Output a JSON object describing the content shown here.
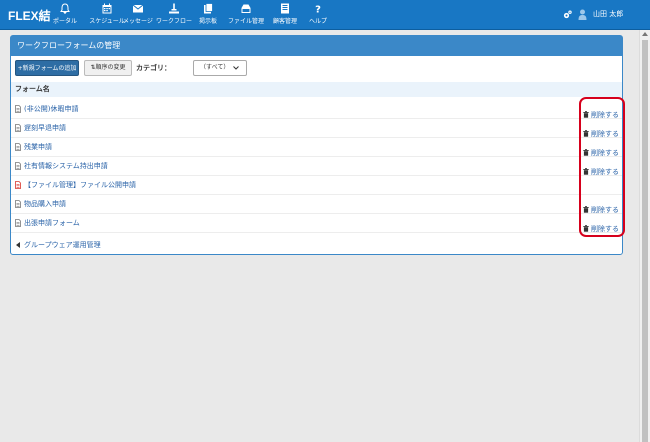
{
  "app": {
    "logo": "FLEX結",
    "nav": [
      {
        "label": "ポータル",
        "icon": "bell-icon"
      },
      {
        "label": "スケジュール",
        "icon": "calendar-icon"
      },
      {
        "label": "メッセージ",
        "icon": "envelope-icon"
      },
      {
        "label": "ワークフロー",
        "icon": "workflow-icon"
      },
      {
        "label": "掲示板",
        "icon": "board-icon"
      },
      {
        "label": "ファイル管理",
        "icon": "file-icon"
      },
      {
        "label": "顧客管理",
        "icon": "customer-icon"
      },
      {
        "label": "ヘルプ",
        "icon": "help-icon"
      }
    ],
    "user_name": "山田 太郎"
  },
  "panel": {
    "title": "ワークフローフォームの管理",
    "new_form_button": "+新規フォームの追加",
    "reorder_button": "順序の変更",
    "category_label": "カテゴリ：",
    "category_value": "（すべて）"
  },
  "table": {
    "column_header": "フォーム名",
    "rows": [
      {
        "name": "(非公開)休暇申請",
        "delete": "削除する",
        "icon_color": "#777777"
      },
      {
        "name": "遅刻早退申請",
        "delete": "削除する",
        "icon_color": "#777777"
      },
      {
        "name": "残業申請",
        "delete": "削除する",
        "icon_color": "#777777"
      },
      {
        "name": "社有情報システム持出申請",
        "delete": "削除する",
        "icon_color": "#777777"
      },
      {
        "name": "【ファイル管理】ファイル公開申請",
        "delete": "",
        "icon_color": "#d9342b"
      },
      {
        "name": "物品購入申請",
        "delete": "削除する",
        "icon_color": "#777777"
      },
      {
        "name": "出張申請フォーム",
        "delete": "削除する",
        "icon_color": "#777777"
      }
    ]
  },
  "footer": {
    "back_link": "グループウェア運用管理"
  },
  "colors": {
    "topbar": "#1877c4",
    "panel_header": "#3b88c8",
    "link": "#2a63a8",
    "highlight": "#d6001c"
  }
}
